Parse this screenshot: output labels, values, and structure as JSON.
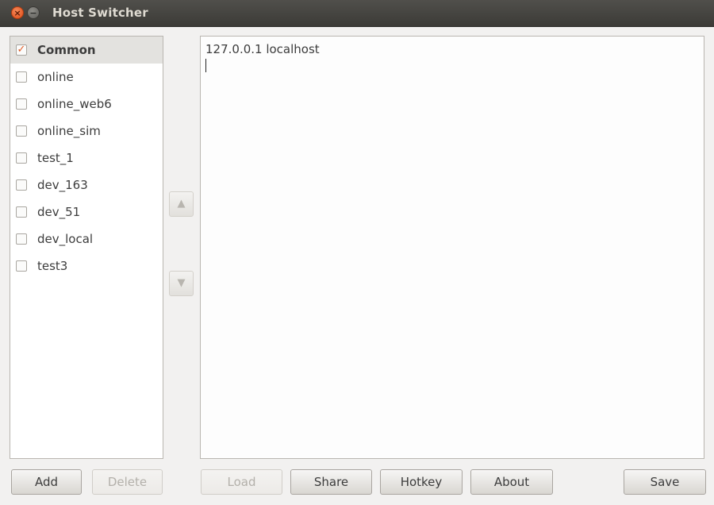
{
  "window": {
    "title": "Host Switcher"
  },
  "sidebar": {
    "items": [
      {
        "label": "Common",
        "checked": true,
        "selected": true
      },
      {
        "label": "online",
        "checked": false,
        "selected": false
      },
      {
        "label": "online_web6",
        "checked": false,
        "selected": false
      },
      {
        "label": "online_sim",
        "checked": false,
        "selected": false
      },
      {
        "label": "test_1",
        "checked": false,
        "selected": false
      },
      {
        "label": "dev_163",
        "checked": false,
        "selected": false
      },
      {
        "label": "dev_51",
        "checked": false,
        "selected": false
      },
      {
        "label": "dev_local",
        "checked": false,
        "selected": false
      },
      {
        "label": "test3",
        "checked": false,
        "selected": false
      }
    ]
  },
  "icons": {
    "move_up": "▲",
    "move_down": "▼",
    "check": "✓",
    "close": "×",
    "minimize": "−"
  },
  "editor": {
    "line1": "127.0.0.1 localhost"
  },
  "buttons": {
    "add": "Add",
    "delete": "Delete",
    "load": "Load",
    "share": "Share",
    "hotkey": "Hotkey",
    "about": "About",
    "save": "Save"
  }
}
